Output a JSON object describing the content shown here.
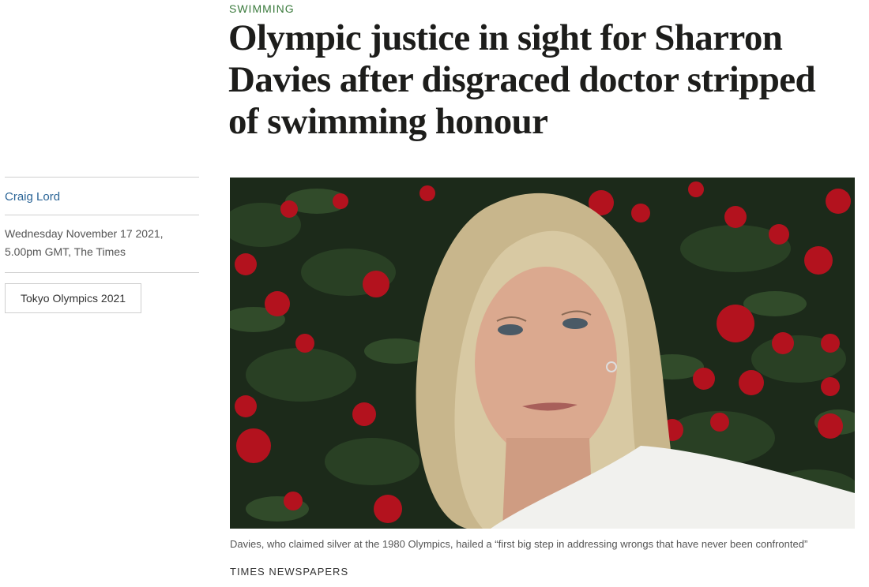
{
  "article": {
    "section": "SWIMMING",
    "headline": "Olympic justice in sight for Sharron Davies after disgraced doctor stripped of swimming honour",
    "author": "Craig Lord",
    "dateline": "Wednesday November 17 2021, 5.00pm GMT, The Times",
    "topic_tag": "Tokyo Olympics 2021",
    "image": {
      "caption": "Davies, who claimed silver at the 1980 Olympics, hailed a “first big step in addressing wrongs that have never been confronted”",
      "credit": "TIMES NEWSPAPERS"
    }
  },
  "colors": {
    "section": "#3a7a3c",
    "author_link": "#2a6496",
    "foliage": "#1c2a1a",
    "flowers": "#b3121e"
  }
}
